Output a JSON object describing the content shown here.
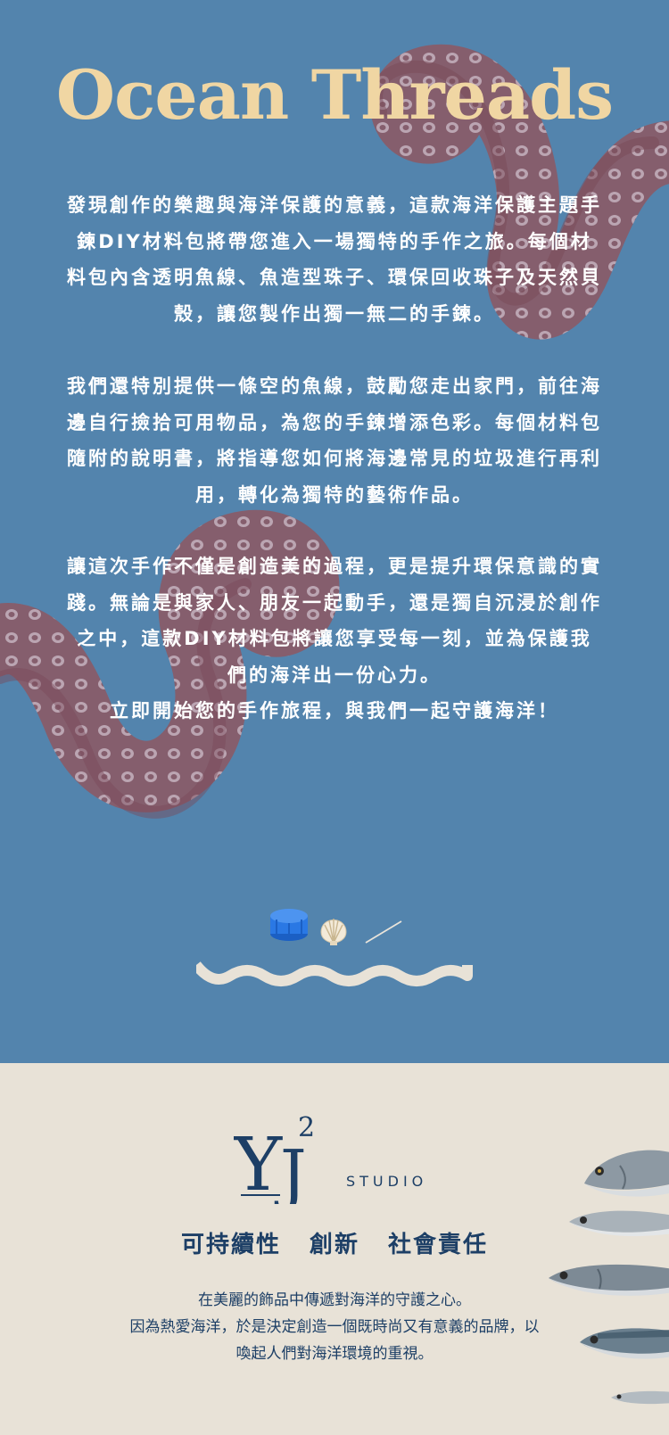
{
  "header": {
    "title": "Ocean Threads"
  },
  "intro": {
    "paragraph_1": "發現創作的樂趣與海洋保護的意義，這款海洋保護主題手鍊DIY材料包將帶您進入一場獨特的手作之旅。每個材料包內含透明魚線、魚造型珠子、環保回收珠子及天然貝殼，讓您製作出獨一無二的手鍊。",
    "paragraph_2": "我們還特別提供一條空的魚線，鼓勵您走出家門，前往海邊自行撿拾可用物品，為您的手鍊增添色彩。每個材料包隨附的說明書，將指導您如何將海邊常見的垃圾進行再利用，轉化為獨特的藝術作品。",
    "paragraph_3": "讓這次手作不僅是創造美的過程，更是提升環保意識的實踐。無論是與家人、朋友一起動手，還是獨自沉浸於創作之中，這款DIY材料包將讓您享受每一刻，並為保護我們的海洋出一份心力。",
    "closing": "立即開始您的手作旅程，與我們一起守護海洋！"
  },
  "icons": [
    "bottle-cap-icon",
    "seashell-icon",
    "fishing-line-icon",
    "wave-divider-icon",
    "octopus-tentacle-illustration",
    "fish-illustration"
  ],
  "brand": {
    "logo_letters": "Y",
    "logo_super": "2",
    "logo_j": "J",
    "logo_studio": "STUDIO",
    "values": [
      "可持續性",
      "創新",
      "社會責任"
    ],
    "mission_line_1": "在美麗的飾品中傳遞對海洋的守護之心。",
    "mission_line_2": "因為熱愛海洋，於是決定創造一個既時尚又有意義的品牌，以喚起人們對海洋環境的重視。"
  },
  "colors": {
    "ocean_blue": "#5384ad",
    "title_cream": "#f0d6a3",
    "sand": "#e8e2d7",
    "navy": "#1d3f66",
    "tentacle": "#8a5a66"
  }
}
